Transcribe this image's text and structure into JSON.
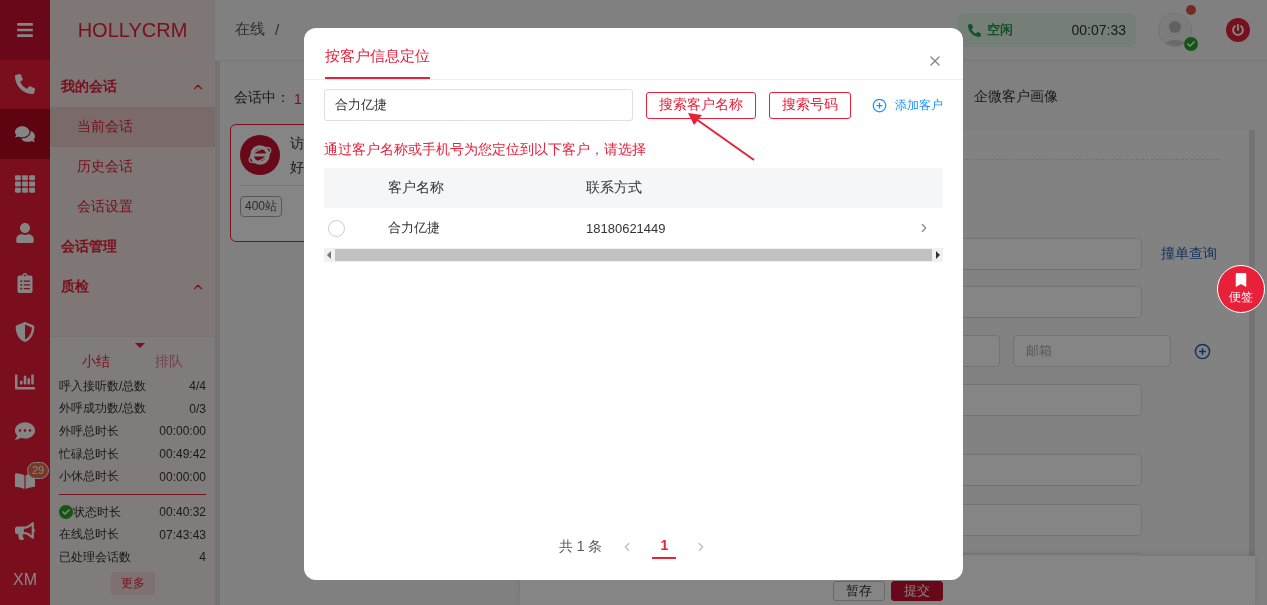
{
  "logo": "HOLLYCRM",
  "breadcrumb": [
    "在线",
    "/"
  ],
  "agent_status": {
    "label": "空闲",
    "timer": "00:07:33"
  },
  "rail": [
    {
      "kind": "phone",
      "selected": false
    },
    {
      "kind": "chat",
      "selected": true
    },
    {
      "kind": "grid",
      "selected": false
    },
    {
      "kind": "person",
      "selected": false
    },
    {
      "kind": "clipboard",
      "selected": false
    },
    {
      "kind": "shield",
      "selected": false
    },
    {
      "kind": "chart",
      "selected": false
    },
    {
      "kind": "messages",
      "selected": false
    },
    {
      "kind": "book",
      "selected": false,
      "badge": "29"
    },
    {
      "kind": "megaphone",
      "selected": false
    },
    {
      "kind": "text",
      "selected": false,
      "label": "XM"
    }
  ],
  "menu": [
    {
      "label": "我的会话",
      "expanded": true,
      "children": [
        {
          "label": "当前会话",
          "selected": true
        },
        {
          "label": "历史会话",
          "selected": false
        },
        {
          "label": "会话设置",
          "selected": false
        }
      ]
    },
    {
      "label": "会话管理"
    },
    {
      "label": "质检",
      "expanded": true
    }
  ],
  "summary": {
    "tabs": [
      {
        "label": "小结",
        "selected": true
      },
      {
        "label": "排队",
        "selected": false
      }
    ],
    "rows": [
      {
        "label": "呼入接听数/总数",
        "value": "4/4"
      },
      {
        "label": "外呼成功数/总数",
        "value": "0/3"
      },
      {
        "label": "外呼总时长",
        "value": "00:00:00"
      },
      {
        "label": "忙碌总时长",
        "value": "00:49:42"
      },
      {
        "label": "小休总时长",
        "value": "00:00:00"
      }
    ],
    "status_rows": [
      {
        "label": "状态时长",
        "value": "00:40:32",
        "kind": "status"
      },
      {
        "label": "在线总时长",
        "value": "07:43:43",
        "kind": "plain"
      },
      {
        "label": "已处理会话数",
        "value": "4",
        "kind": "plain"
      }
    ],
    "more": "更多"
  },
  "workspace": {
    "count_label": "会话中：",
    "count": "1",
    "session_card": {
      "lines": [
        "访",
        "好"
      ],
      "tags": [
        "400站"
      ]
    },
    "tab_label": "企微客户画像",
    "lookup_link": "撞单查询",
    "email_placeholder": "邮箱",
    "actions": [
      {
        "label": "暂存",
        "kind": "default"
      },
      {
        "label": "提交",
        "kind": "primary"
      }
    ]
  },
  "sticky_note": "便签",
  "dialog": {
    "tabs": [
      {
        "label": "按客户信息定位",
        "selected": true
      }
    ],
    "search": {
      "value": "合力亿捷"
    },
    "buttons": [
      "搜索客户名称",
      "搜索号码"
    ],
    "add_link": "添加客户",
    "hint": "通过客户名称或手机号为您定位到以下客户，请选择",
    "table": {
      "columns": [
        "客户名称",
        "联系方式"
      ],
      "rows": [
        {
          "selected": false,
          "name": "合力亿捷",
          "phone": "18180621449"
        }
      ]
    },
    "pagination": {
      "total": "共 1 条",
      "pages": [
        {
          "label": "1",
          "selected": true
        }
      ]
    }
  }
}
